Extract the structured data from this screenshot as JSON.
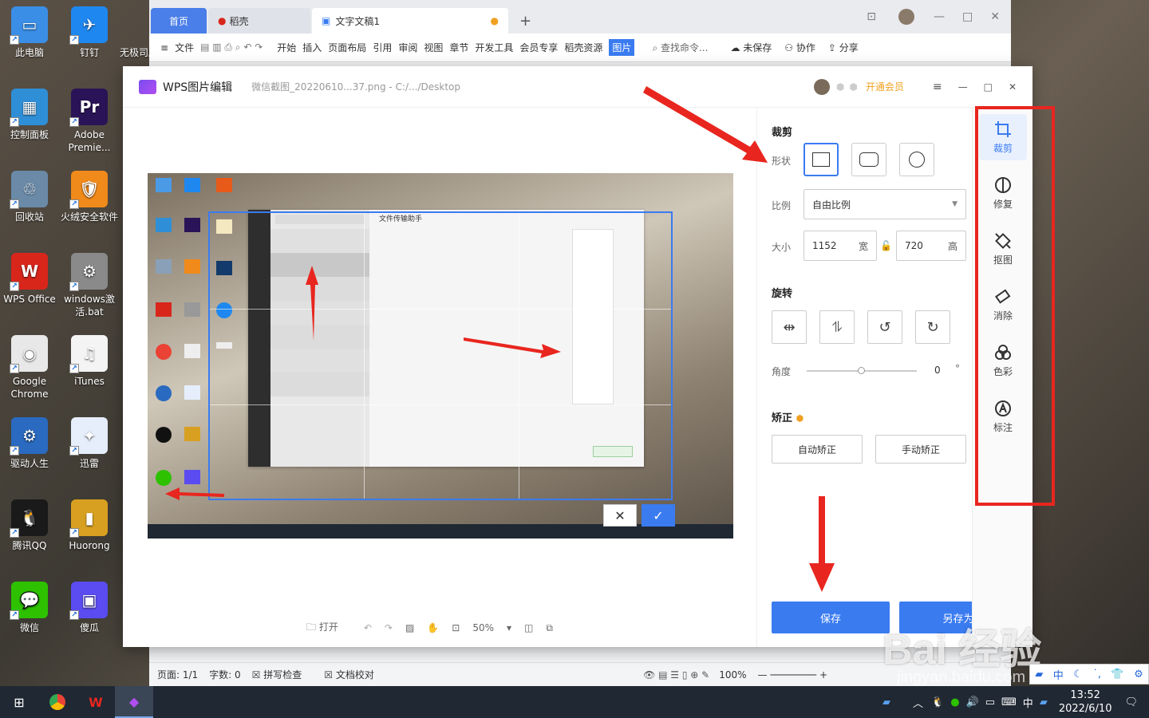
{
  "desktop": {
    "icons": [
      {
        "label": "此电脑",
        "color": "#3a8ee6",
        "glyph": "▭"
      },
      {
        "label": "钉钉",
        "color": "#1e88f0",
        "glyph": "✈"
      },
      {
        "label": "控制面板",
        "color": "#2f8fd6",
        "glyph": "▦"
      },
      {
        "label": "Adobe Premie...",
        "color": "#2a1457",
        "glyph": "Pr"
      },
      {
        "label": "回收站",
        "color": "#6a8aa8",
        "glyph": "♲"
      },
      {
        "label": "火绒安全软件",
        "color": "#f08a1a",
        "glyph": "🛡"
      },
      {
        "label": "WPS Office",
        "color": "#d8261b",
        "glyph": "W"
      },
      {
        "label": "windows激活.bat",
        "color": "#8a8a8a",
        "glyph": "⚙"
      },
      {
        "label": "Google Chrome",
        "color": "#e8e8e8",
        "glyph": "◉"
      },
      {
        "label": "iTunes",
        "color": "#f4f4f4",
        "glyph": "♫"
      },
      {
        "label": "驱动人生",
        "color": "#2a6ac0",
        "glyph": "⚙"
      },
      {
        "label": "迅雷",
        "color": "#e6eefc",
        "glyph": "✦"
      },
      {
        "label": "腾讯QQ",
        "color": "#1a1a1a",
        "glyph": "🐧"
      },
      {
        "label": "Huorong",
        "color": "#d8a020",
        "glyph": "▮"
      },
      {
        "label": "微信",
        "color": "#2dc100",
        "glyph": "💬"
      },
      {
        "label": "傻瓜",
        "color": "#5a4cf0",
        "glyph": "▣"
      }
    ],
    "partial_label": "无极司脑之"
  },
  "writer": {
    "tabs": {
      "home": "首页",
      "daoke": "稻壳",
      "doc": "文字文稿1",
      "add": "+"
    },
    "menu": [
      "文件",
      "开始",
      "插入",
      "页面布局",
      "引用",
      "审阅",
      "视图",
      "章节",
      "开发工具",
      "会员专享",
      "稻壳资源",
      "图片"
    ],
    "search": "查找命令...",
    "unsaved": "未保存",
    "collab": "协作",
    "share": "分享",
    "status": {
      "page": "页面: 1/1",
      "words": "字数: 0",
      "spell": "拼写检查",
      "proof": "文档校对",
      "zoom": "100%"
    }
  },
  "editor": {
    "app_name": "WPS图片编辑",
    "file_name": "微信截图_20220610...37.png - C:/.../Desktop",
    "vip": "开通会员",
    "crop_section": "裁剪",
    "shape_label": "形状",
    "ratio_label": "比例",
    "ratio_value": "自由比例",
    "size_label": "大小",
    "width_value": "1152",
    "width_unit": "宽",
    "height_value": "720",
    "height_unit": "高",
    "rotate_section": "旋转",
    "angle_label": "角度",
    "angle_value": "0",
    "angle_unit": "°",
    "correct_section": "矫正",
    "auto_correct": "自动矫正",
    "manual_correct": "手动矫正",
    "save": "保存",
    "save_as": "另存为",
    "bottom": {
      "open": "打开",
      "zoom": "50%"
    },
    "tools": [
      {
        "label": "裁剪",
        "icon": "crop-icon"
      },
      {
        "label": "修复",
        "icon": "repair-icon"
      },
      {
        "label": "抠图",
        "icon": "cutout-icon"
      },
      {
        "label": "消除",
        "icon": "eraser-icon"
      },
      {
        "label": "色彩",
        "icon": "color-icon"
      },
      {
        "label": "标注",
        "icon": "annotate-icon"
      }
    ],
    "preview_title": "文件传输助手"
  },
  "taskbar": {
    "time": "13:52",
    "date": "2022/6/10",
    "ime": "中"
  },
  "watermark": {
    "text": "Bai 经验",
    "sub": "jingyan.baidu.com"
  },
  "colors": {
    "accent": "#3a7bf0",
    "annotation": "#e8261f",
    "vip": "#f0a020"
  }
}
